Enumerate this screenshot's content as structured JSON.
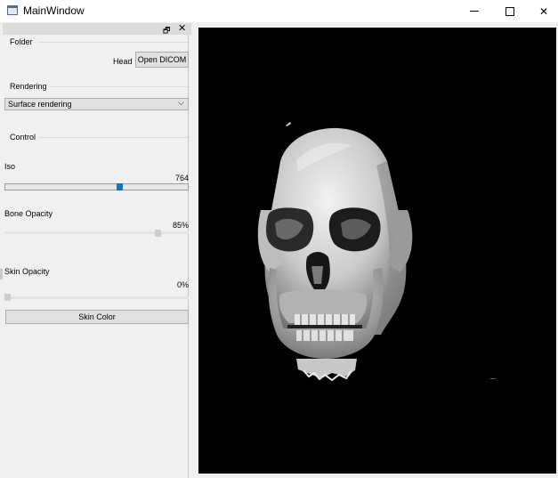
{
  "window": {
    "title": "MainWindow"
  },
  "dock": {
    "float_glyph": "🗗",
    "close_glyph": "✕",
    "folder": {
      "group_title": "Folder",
      "current_label": "Head",
      "open_button": "Open DICOM"
    },
    "rendering": {
      "group_title": "Rendering",
      "mode": "Surface rendering"
    },
    "control": {
      "group_title": "Control",
      "iso": {
        "label": "Iso",
        "value": "764"
      },
      "bone_opacity": {
        "label": "Bone Opacity",
        "value": "85%"
      },
      "skin_opacity": {
        "label": "Skin Opacity",
        "value": "0%"
      },
      "skin_color_button": "Skin Color"
    }
  },
  "viewer": {
    "content": "3D surface rendering of skull",
    "background": "#000000"
  }
}
